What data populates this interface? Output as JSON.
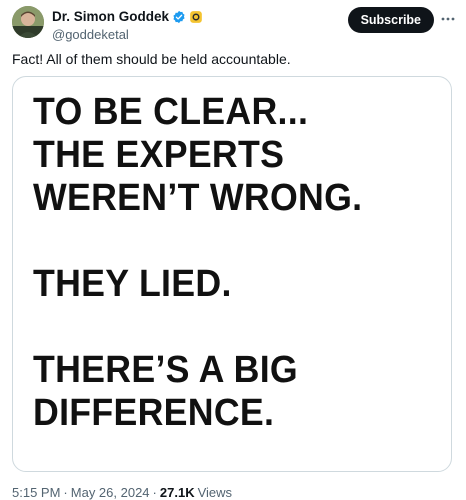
{
  "author": {
    "name": "Dr. Simon Goddek",
    "handle": "@goddeketal",
    "verified_icon": "verified-check-icon",
    "affiliate_icon": "gold-badge-icon"
  },
  "actions": {
    "subscribe_label": "Subscribe",
    "more_icon": "more-dots-icon"
  },
  "tweet": {
    "text": "Fact! All of them should be held accountable."
  },
  "media": {
    "lines": [
      "TO BE CLEAR...",
      "THE EXPERTS",
      "WEREN’T WRONG.",
      "",
      "THEY LIED.",
      "",
      "THERE’S A BIG",
      "DIFFERENCE."
    ]
  },
  "meta": {
    "time": "5:15 PM",
    "sep1": "·",
    "date": "May 26, 2024",
    "sep2": "·",
    "views_count": "27.1K",
    "views_label": "Views"
  },
  "colors": {
    "text_primary": "#0f1419",
    "text_secondary": "#536471",
    "verified_blue": "#1d9bf0",
    "subscribe_bg": "#0f1419",
    "border": "#cfd9de"
  }
}
